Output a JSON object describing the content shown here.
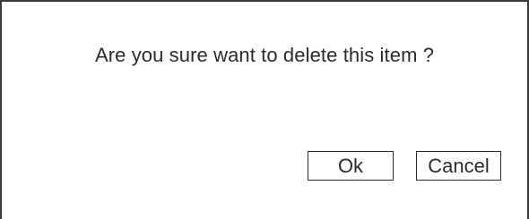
{
  "dialog": {
    "message": "Are you sure want to delete this item ?",
    "ok_label": "Ok",
    "cancel_label": "Cancel"
  }
}
